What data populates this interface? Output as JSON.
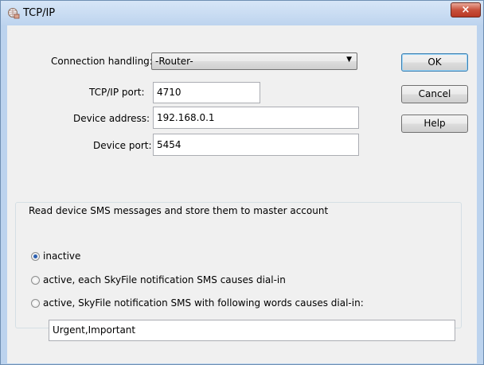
{
  "window": {
    "title": "TCP/IP",
    "close_glyph": "×",
    "app_icon": "network-globe-icon"
  },
  "form": {
    "connection_handling": {
      "label": "Connection handling:",
      "value": "-Router-",
      "dropdown_glyph": "▼"
    },
    "tcpip_port": {
      "label": "TCP/IP port:",
      "value": "4710"
    },
    "device_address": {
      "label": "Device address:",
      "value": "192.168.0.1"
    },
    "device_port": {
      "label": "Device port:",
      "value": "5454"
    }
  },
  "buttons": {
    "ok": "OK",
    "cancel": "Cancel",
    "help": "Help"
  },
  "sms_group": {
    "title": "Read device SMS messages and store them to master account",
    "options": [
      {
        "label": "inactive",
        "checked": true
      },
      {
        "label": "active, each SkyFile notification SMS causes dial-in",
        "checked": false
      },
      {
        "label": "active, SkyFile notification SMS with following words causes dial-in:",
        "checked": false
      }
    ],
    "keywords_value": "Urgent,Important"
  },
  "colors": {
    "title_bar": "#bcd3ee",
    "close_button": "#c8513c",
    "client_bg": "#f0f0f0",
    "radio_dot": "#2b5fb0"
  }
}
